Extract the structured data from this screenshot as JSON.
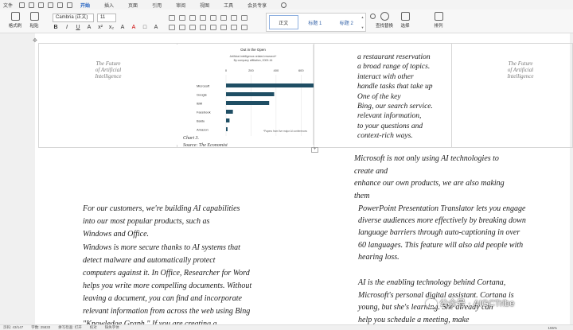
{
  "menu": {
    "file": "文件",
    "tabs": [
      "开始",
      "插入",
      "页面",
      "引用",
      "审阅",
      "视图",
      "工具",
      "会员专享"
    ],
    "active_tab": "开始"
  },
  "ribbon": {
    "format_painter": "格式刷",
    "paste": "粘贴",
    "font_name": "Cambria (正文)",
    "font_size": "11",
    "styles": [
      "正文",
      "标题 1",
      "标题 2"
    ],
    "find_replace": "查找替换",
    "select": "选择",
    "arrange": "排列"
  },
  "table": {
    "left_title": [
      "The Future",
      "of Artificial",
      "Intelligence"
    ],
    "right_title": [
      "The Future",
      "of Artificial",
      "Intelligence"
    ],
    "right_list": [
      "a restaurant reservation",
      "a broad range of topics.",
      "interact with other",
      "handle tasks that take up",
      "One of the key",
      "Bing, our search service.",
      "relevant information,",
      "to your questions and",
      "context-rich ways."
    ],
    "caption": [
      "Chart 3.",
      "Source: The Economist"
    ]
  },
  "chart_data": {
    "type": "bar",
    "orientation": "horizontal",
    "title": "Out in the Open",
    "subtitle": [
      "Artificial-intelligence-related research*",
      "By company affiliation, 2009-16"
    ],
    "categories": [
      "Microsoft",
      "Google",
      "IBM",
      "Facebook",
      "Baidu",
      "Amazon"
    ],
    "values": [
      700,
      385,
      345,
      55,
      28,
      12
    ],
    "xticks": [
      "0",
      "200",
      "400",
      "600"
    ],
    "xlim": [
      0,
      700
    ],
    "footnote": "*Papers from five major AI conferences",
    "bar_color": "#1f4e64",
    "grid": true
  },
  "body": {
    "ms_para": [
      "Microsoft is not only using AI technologies to",
      "create and",
      "enhance our own products, we are also making",
      "them"
    ],
    "customers_para": [
      "For our customers, we're building AI capabilities",
      "into our most popular products, such as",
      "Windows and Office."
    ],
    "windows_para": [
      "Windows is more secure thanks to AI systems that",
      "detect malware and automatically protect",
      "computers against it. In Office, Researcher for Word",
      "helps you write more compelling documents. Without",
      "leaving a document, you can find and incorporate",
      "relevant information from across the web using Bing",
      "\"Knowledge Graph.\" If you are creating a"
    ],
    "powerpoint_para": [
      "PowerPoint Presentation Translator lets you engage",
      "diverse audiences more effectively by breaking down",
      "language barriers through auto-captioning in over",
      "60 languages. This feature will also aid people with",
      "hearing loss."
    ],
    "ai_para": [
      "AI is the enabling technology behind Cortana,",
      "Microsoft's personal digital assistant. Cortana is",
      "young, but she's learning. She already can",
      "help you schedule a meeting, make"
    ]
  },
  "watermark": "公众号 · AIGCTribe",
  "status": {
    "page": "页码: 43/147",
    "words": "字数: 25833",
    "spell": "拼写检查: 打开",
    "check": "校对",
    "missing_font": "缺失字体",
    "zoom": "155%"
  }
}
